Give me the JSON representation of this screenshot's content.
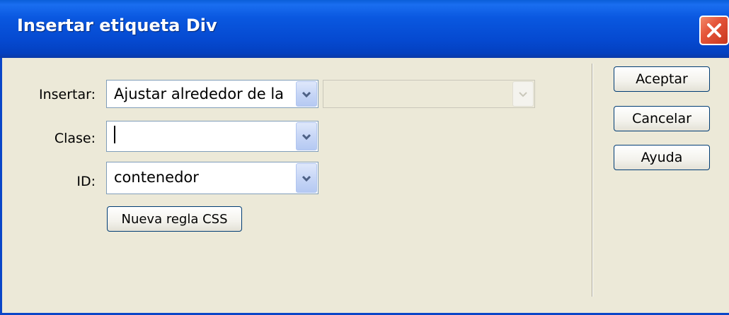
{
  "window": {
    "title": "Insertar etiqueta Div",
    "close_icon": "close-icon"
  },
  "form": {
    "insertar": {
      "label": "Insertar:",
      "value": "Ajustar alrededor de la",
      "secondary_value": ""
    },
    "clase": {
      "label": "Clase:",
      "value": ""
    },
    "id": {
      "label": "ID:",
      "value": "contenedor"
    },
    "new_rule_button": "Nueva regla CSS"
  },
  "buttons": {
    "accept": "Aceptar",
    "cancel": "Cancelar",
    "help": "Ayuda"
  },
  "colors": {
    "titlebar": "#0549d0",
    "dialog_bg": "#ece9d8",
    "close_button": "#e5553a"
  }
}
